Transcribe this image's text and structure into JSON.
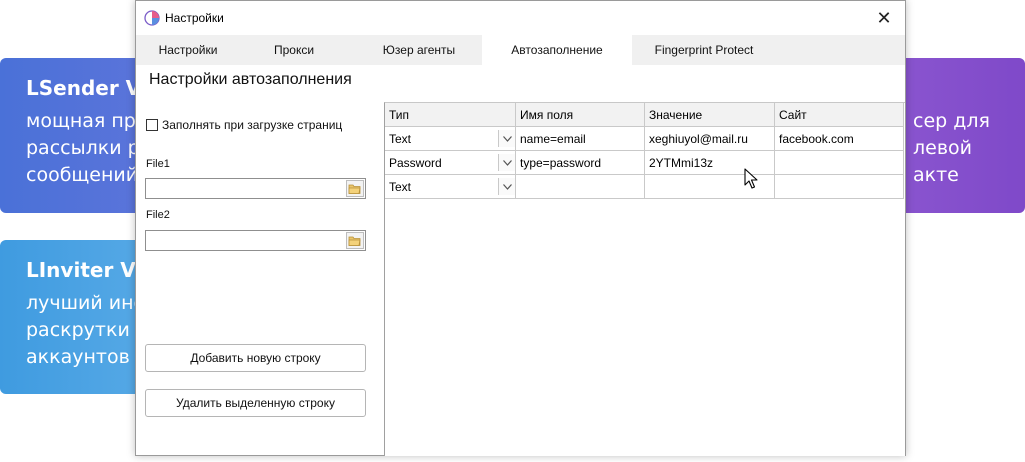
{
  "background": {
    "lsender": {
      "title": "LSender VK",
      "lines": [
        "мощная про",
        "рассылки р",
        "сообщений"
      ]
    },
    "linviter": {
      "title": "LInviter VK",
      "lines": [
        "лучший инс",
        "раскрутки",
        "аккаунтов"
      ]
    },
    "right": {
      "lines": [
        "сер для",
        "левой",
        "акте"
      ]
    }
  },
  "window": {
    "title": "Настройки",
    "close_label": "✕",
    "tabs": [
      {
        "label": "Настройки",
        "active": false
      },
      {
        "label": "Прокси",
        "active": false
      },
      {
        "label": "Юзер агенты",
        "active": false
      },
      {
        "label": "Автозаполнение",
        "active": true
      },
      {
        "label": "Fingerprint Protect",
        "active": false
      }
    ],
    "section_title": "Настройки автозаполнения"
  },
  "left_panel": {
    "checkbox_label": "Заполнять при загрузке страниц",
    "checkbox_checked": false,
    "file1_label": "File1",
    "file1_value": "",
    "file2_label": "File2",
    "file2_value": "",
    "add_row_label": "Добавить новую строку",
    "delete_row_label": "Удалить выделенную строку"
  },
  "grid": {
    "columns": [
      "Тип",
      "Имя поля",
      "Значение",
      "Сайт"
    ],
    "rows": [
      {
        "type": "Text",
        "field": "name=email",
        "value": "xeghiuyol@mail.ru",
        "site": "facebook.com"
      },
      {
        "type": "Password",
        "field": "type=password",
        "value": "2YTMmi13z",
        "site": ""
      },
      {
        "type": "Text",
        "field": "",
        "value": "",
        "site": ""
      }
    ]
  },
  "colors": {
    "lsender_card": "#4a71d8",
    "linviter_card": "#3f9be0",
    "right_card": "#8a55cf",
    "tab_bar": "#f0f0f0"
  }
}
